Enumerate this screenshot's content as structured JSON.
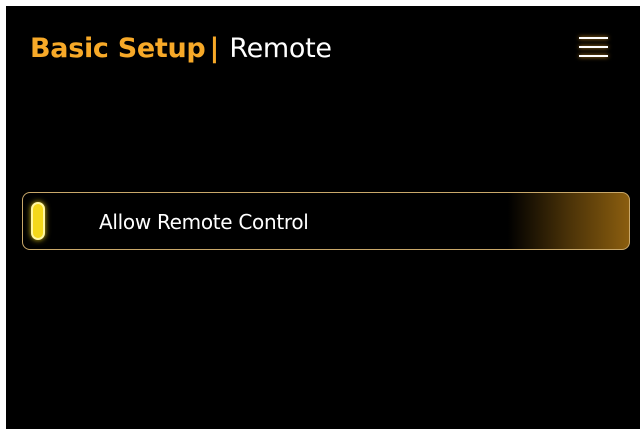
{
  "header": {
    "title": "Basic Setup",
    "separator": "|",
    "subtitle": "Remote"
  },
  "menu": {
    "icon": "hamburger-menu-icon"
  },
  "settings": {
    "items": [
      {
        "label": "Allow Remote Control",
        "enabled": true,
        "indicator_color": "#f4d81a"
      }
    ]
  },
  "colors": {
    "accent": "#f7a928",
    "background": "#000000",
    "text": "#ffffff",
    "row_border": "#c9a86a",
    "row_gradient_end": "#8b5e0f"
  }
}
